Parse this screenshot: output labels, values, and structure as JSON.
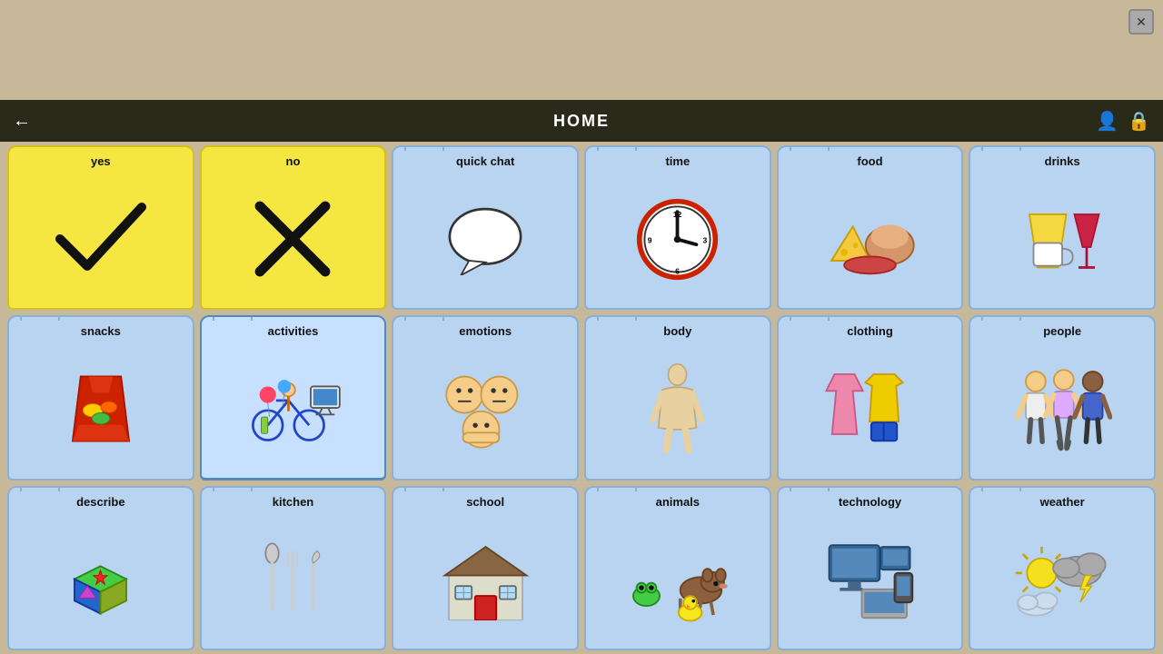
{
  "navbar": {
    "title": "HOME",
    "back_icon": "←",
    "user_icon": "👤",
    "lock_icon": "🔒"
  },
  "close_button": "✕",
  "cells": [
    {
      "id": "yes",
      "label": "yes",
      "type": "yellow",
      "icon": "check"
    },
    {
      "id": "no",
      "label": "no",
      "type": "yellow",
      "icon": "xmark"
    },
    {
      "id": "quick_chat",
      "label": "quick chat",
      "type": "blue",
      "icon": "speech_bubble"
    },
    {
      "id": "time",
      "label": "time",
      "type": "blue",
      "icon": "clock"
    },
    {
      "id": "food",
      "label": "food",
      "type": "blue",
      "icon": "food"
    },
    {
      "id": "drinks",
      "label": "drinks",
      "type": "blue",
      "icon": "drinks"
    },
    {
      "id": "snacks",
      "label": "snacks",
      "type": "blue",
      "icon": "snacks"
    },
    {
      "id": "activities",
      "label": "activities",
      "type": "blue",
      "icon": "activities",
      "active": true
    },
    {
      "id": "emotions",
      "label": "emotions",
      "type": "blue",
      "icon": "emotions"
    },
    {
      "id": "body",
      "label": "body",
      "type": "blue",
      "icon": "body"
    },
    {
      "id": "clothing",
      "label": "clothing",
      "type": "blue",
      "icon": "clothing"
    },
    {
      "id": "people",
      "label": "people",
      "type": "blue",
      "icon": "people"
    },
    {
      "id": "describe",
      "label": "describe",
      "type": "blue",
      "icon": "describe"
    },
    {
      "id": "kitchen",
      "label": "kitchen",
      "type": "blue",
      "icon": "kitchen"
    },
    {
      "id": "school",
      "label": "school",
      "type": "blue",
      "icon": "school"
    },
    {
      "id": "animals",
      "label": "animals",
      "type": "blue",
      "icon": "animals"
    },
    {
      "id": "technology",
      "label": "technology",
      "type": "blue",
      "icon": "technology"
    },
    {
      "id": "weather",
      "label": "weather",
      "type": "blue",
      "icon": "weather"
    }
  ]
}
